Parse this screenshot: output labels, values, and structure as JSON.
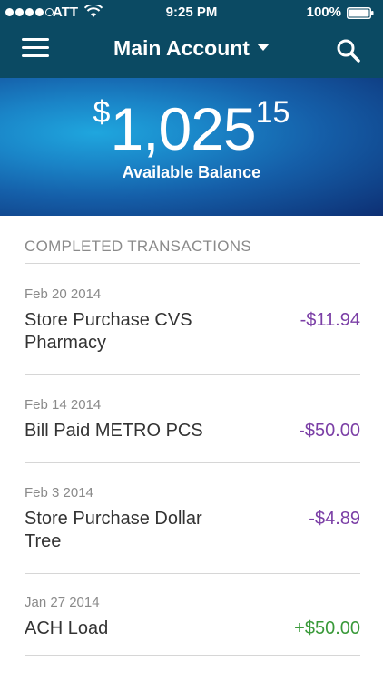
{
  "status_bar": {
    "carrier": "ATT",
    "time": "9:25 PM",
    "battery": "100%"
  },
  "header": {
    "account_title": "Main Account",
    "menu_icon": "hamburger-menu-icon",
    "search_icon": "search-icon"
  },
  "balance": {
    "currency": "$",
    "dollars": "1,025",
    "cents": "15",
    "label": "Available Balance"
  },
  "transactions": {
    "heading": "COMPLETED TRANSACTIONS",
    "items": [
      {
        "date": "Feb 20 2014",
        "description": "Store Purchase CVS Pharmacy",
        "amount": "-$11.94",
        "type": "debit"
      },
      {
        "date": "Feb 14 2014",
        "description": "Bill Paid METRO PCS",
        "amount": "-$50.00",
        "type": "debit"
      },
      {
        "date": "Feb 3 2014",
        "description": "Store Purchase Dollar Tree",
        "amount": "-$4.89",
        "type": "debit"
      },
      {
        "date": "Jan 27 2014",
        "description": "ACH Load",
        "amount": "+$50.00",
        "type": "credit"
      }
    ]
  },
  "colors": {
    "header_bg": "#0b4a63",
    "debit": "#7b3fa6",
    "credit": "#3a9a3a"
  }
}
